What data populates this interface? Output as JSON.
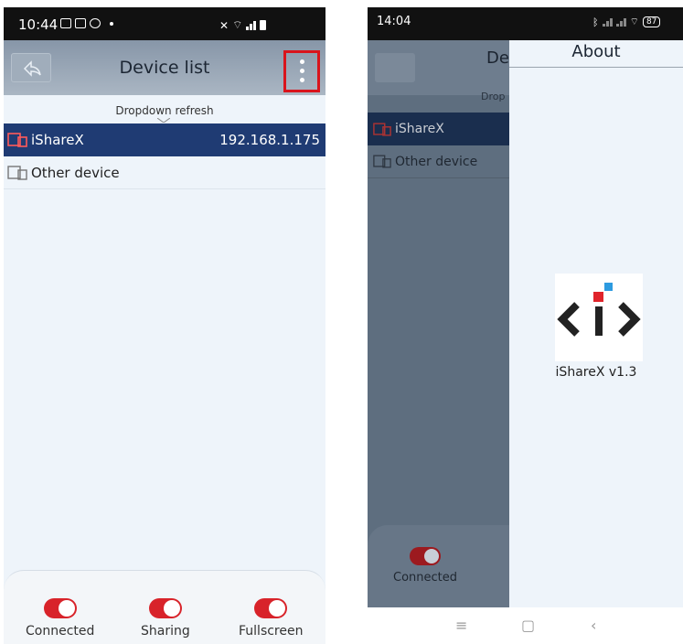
{
  "left": {
    "status": {
      "time": "10:44"
    },
    "header": {
      "title": "Device list"
    },
    "refresh_label": "Dropdown refresh",
    "devices": [
      {
        "name": "iShareX",
        "ip": "192.168.1.175",
        "selected": true
      },
      {
        "name": "Other device",
        "ip": "",
        "selected": false
      }
    ],
    "toggles": [
      {
        "label": "Connected",
        "on": true
      },
      {
        "label": "Sharing",
        "on": true
      },
      {
        "label": "Fullscreen",
        "on": true
      }
    ]
  },
  "right": {
    "status": {
      "time": "14:04",
      "battery": "87"
    },
    "background": {
      "title_fragment": "De",
      "refresh_fragment": "Drop",
      "devices": [
        "iShareX",
        "Other device"
      ],
      "toggle_label": "Connected"
    },
    "drawer": {
      "title": "About",
      "version": "iShareX v1.3"
    },
    "navbar": {
      "menu": "≡",
      "home": "▢",
      "back": "‹"
    }
  },
  "colors": {
    "selected_row": "#1f3b73",
    "toggle_on": "#d8232a",
    "highlight_border": "#d9141c",
    "logo_dark": "#222222",
    "logo_red": "#e0242b",
    "logo_blue": "#2d9be0"
  }
}
